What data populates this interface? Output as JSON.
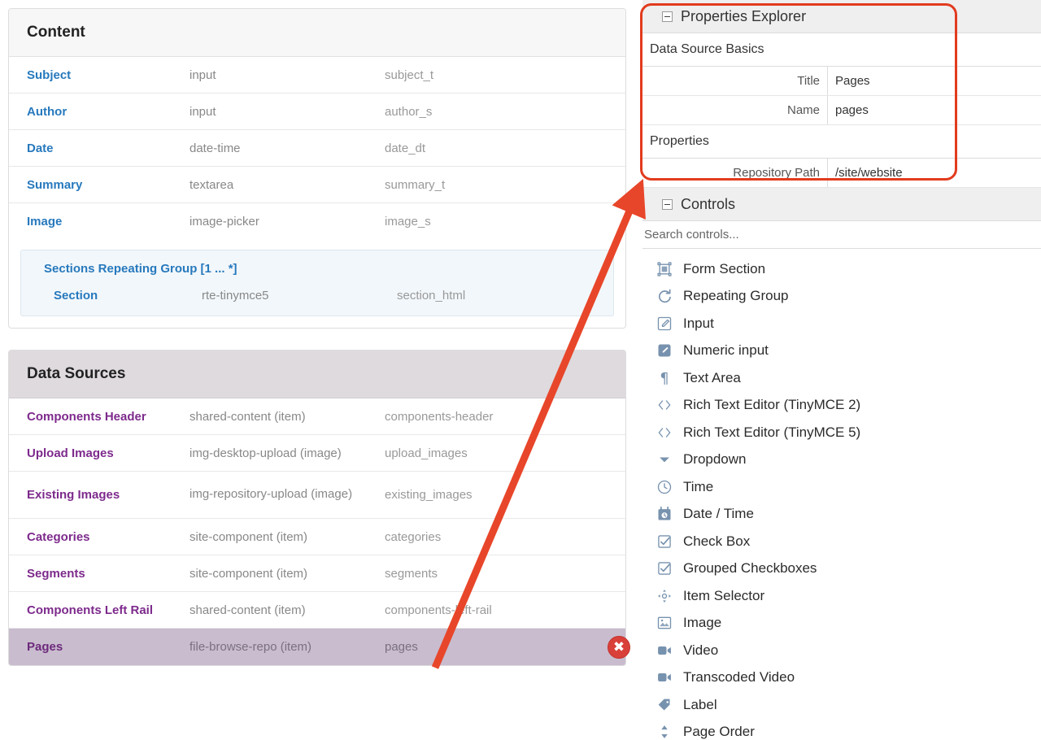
{
  "content_panel": {
    "title": "Content",
    "fields": [
      {
        "name": "Subject",
        "type": "input",
        "id": "subject_t"
      },
      {
        "name": "Author",
        "type": "input",
        "id": "author_s"
      },
      {
        "name": "Date",
        "type": "date-time",
        "id": "date_dt"
      },
      {
        "name": "Summary",
        "type": "textarea",
        "id": "summary_t"
      },
      {
        "name": "Image",
        "type": "image-picker",
        "id": "image_s"
      }
    ],
    "repeating_group": {
      "title": "Sections Repeating Group [1 ... *]",
      "field": {
        "name": "Section",
        "type": "rte-tinymce5",
        "id": "section_html"
      }
    }
  },
  "data_sources_panel": {
    "title": "Data Sources",
    "rows": [
      {
        "name": "Components Header",
        "type": "shared-content (item)",
        "id": "components-header",
        "selected": false
      },
      {
        "name": "Upload Images",
        "type": "img-desktop-upload (image)",
        "id": "upload_images",
        "selected": false
      },
      {
        "name": "Existing Images",
        "type": "img-repository-upload (image)",
        "id": "existing_images",
        "selected": false
      },
      {
        "name": "Categories",
        "type": "site-component (item)",
        "id": "categories",
        "selected": false
      },
      {
        "name": "Segments",
        "type": "site-component (item)",
        "id": "segments",
        "selected": false
      },
      {
        "name": "Components Left Rail",
        "type": "shared-content (item)",
        "id": "components-left-rail",
        "selected": false
      },
      {
        "name": "Pages",
        "type": "file-browse-repo (item)",
        "id": "pages",
        "selected": true
      }
    ],
    "delete_button_label": "✖"
  },
  "properties_explorer": {
    "title": "Properties Explorer",
    "groups": [
      {
        "label": "Data Source Basics",
        "rows": [
          {
            "key": "Title",
            "value": "Pages"
          },
          {
            "key": "Name",
            "value": "pages"
          }
        ]
      },
      {
        "label": "Properties",
        "rows": [
          {
            "key": "Repository Path",
            "value": "/site/website"
          }
        ]
      }
    ]
  },
  "controls_panel": {
    "title": "Controls",
    "search_placeholder": "Search controls...",
    "items": [
      {
        "label": "Form Section",
        "icon": "form-section-icon"
      },
      {
        "label": "Repeating Group",
        "icon": "repeat-icon"
      },
      {
        "label": "Input",
        "icon": "pencil-box-outline-icon"
      },
      {
        "label": "Numeric input",
        "icon": "pencil-box-filled-icon"
      },
      {
        "label": "Text Area",
        "icon": "pilcrow-icon"
      },
      {
        "label": "Rich Text Editor (TinyMCE 2)",
        "icon": "code-brackets-icon"
      },
      {
        "label": "Rich Text Editor (TinyMCE 5)",
        "icon": "code-brackets-icon"
      },
      {
        "label": "Dropdown",
        "icon": "caret-down-icon"
      },
      {
        "label": "Time",
        "icon": "clock-icon"
      },
      {
        "label": "Date / Time",
        "icon": "calendar-clock-icon"
      },
      {
        "label": "Check Box",
        "icon": "checkbox-icon"
      },
      {
        "label": "Grouped Checkboxes",
        "icon": "checkbox-icon"
      },
      {
        "label": "Item Selector",
        "icon": "move-arrows-icon"
      },
      {
        "label": "Image",
        "icon": "image-icon"
      },
      {
        "label": "Video",
        "icon": "video-camera-icon"
      },
      {
        "label": "Transcoded Video",
        "icon": "video-camera-icon"
      },
      {
        "label": "Label",
        "icon": "tag-icon"
      },
      {
        "label": "Page Order",
        "icon": "sort-updown-icon"
      }
    ]
  },
  "colors": {
    "annotation": "#e23b1e",
    "link_blue": "#2779bd",
    "link_purple": "#7d2a8c",
    "selected_row": "#c9bcce",
    "delete_red": "#d9403a"
  }
}
